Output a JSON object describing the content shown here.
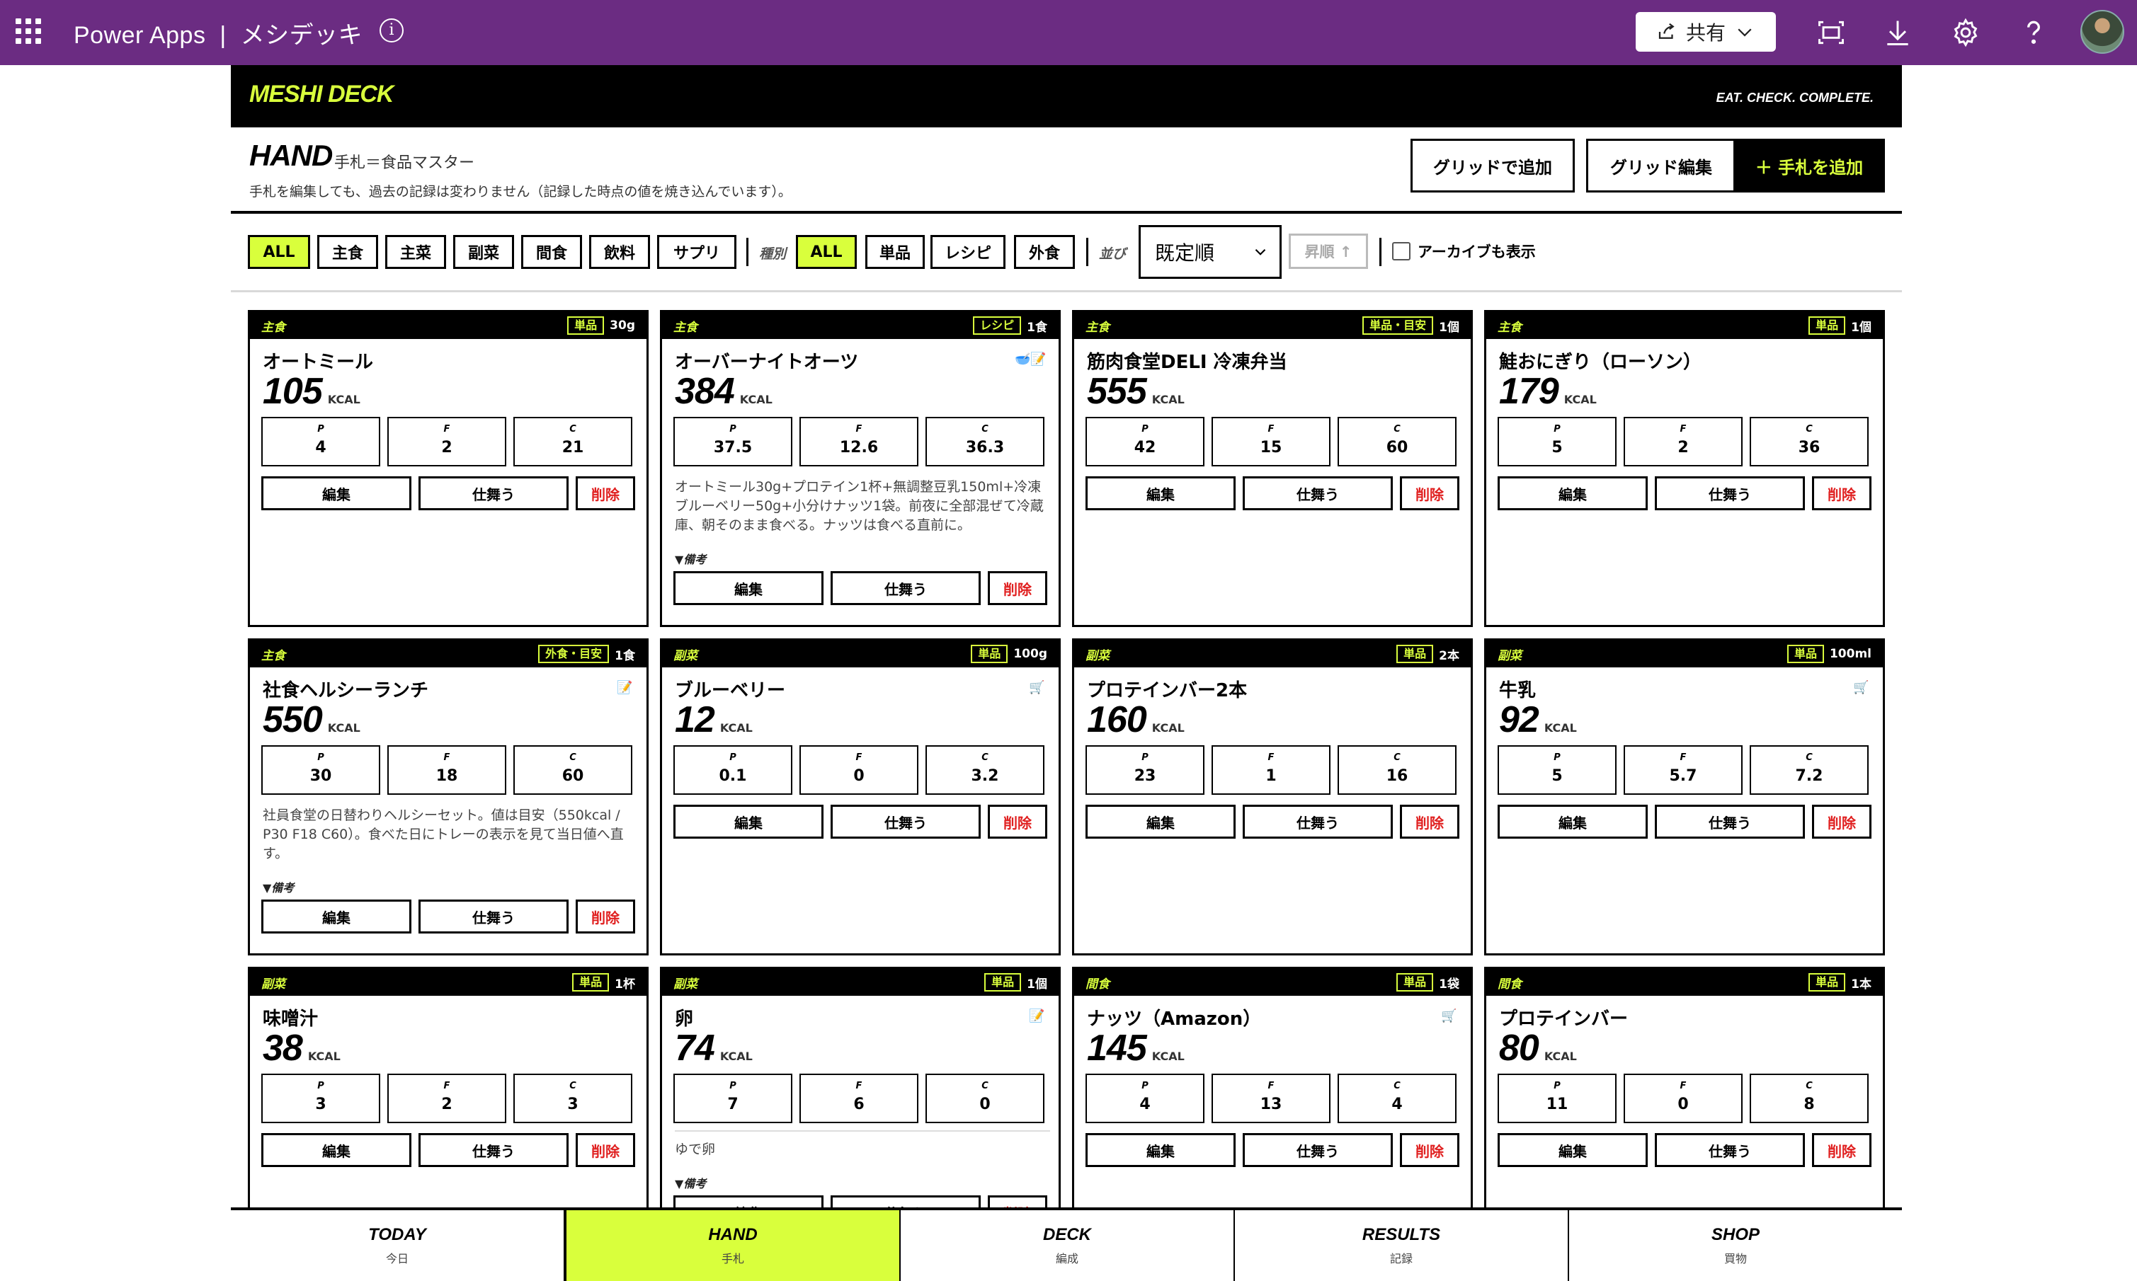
{
  "topbar": {
    "app_name": "Power Apps",
    "separator": "|",
    "app_title": "メシデッキ",
    "share_label": "共有"
  },
  "brand": {
    "logo": "MESHI DECK",
    "tagline": "EAT. CHECK. COMPLETE."
  },
  "hand": {
    "title": "HAND",
    "subtitle": "手札＝食品マスター",
    "note": "手札を編集しても、過去の記録は変わりません（記録した時点の値を焼き込んでいます）。",
    "grid_add": "グリッドで追加",
    "grid_edit": "グリッド編集",
    "add_card": "＋ 手札を追加"
  },
  "filters": {
    "categories": [
      "ALL",
      "主食",
      "主菜",
      "副菜",
      "間食",
      "飲料",
      "サプリ"
    ],
    "kind_label": "種別",
    "kinds": [
      "ALL",
      "単品",
      "レシピ",
      "外食"
    ],
    "sort_label": "並び",
    "sort_value": "既定順",
    "asc_label": "昇順 ↑",
    "archive_label": "アーカイブも表示"
  },
  "card_labels": {
    "kcal": "KCAL",
    "p": "P",
    "f": "F",
    "c": "C",
    "edit": "編集",
    "put_away": "仕舞う",
    "delete": "削除",
    "bikou": "▼備考"
  },
  "cards": [
    {
      "category": "主食",
      "kind": "単品",
      "unit": "30g",
      "name": "オートミール",
      "kcal": "105",
      "p": "4",
      "f": "2",
      "c": "21",
      "memo": "",
      "icon": ""
    },
    {
      "category": "主食",
      "kind": "レシピ",
      "unit": "1食",
      "name": "オーバーナイトオーツ",
      "kcal": "384",
      "p": "37.5",
      "f": "12.6",
      "c": "36.3",
      "memo": "オートミール30g+プロテイン1杯+無調整豆乳150ml+冷凍ブルーベリー50g+小分けナッツ1袋。前夜に全部混ぜて冷蔵庫、朝そのまま食べる。ナッツは食べる直前に。",
      "icon": "bowl-note-icon"
    },
    {
      "category": "主食",
      "kind": "単品・目安",
      "unit": "1個",
      "name": "筋肉食堂DELI 冷凍弁当",
      "kcal": "555",
      "p": "42",
      "f": "15",
      "c": "60",
      "memo": "",
      "icon": ""
    },
    {
      "category": "主食",
      "kind": "単品",
      "unit": "1個",
      "name": "鮭おにぎり（ローソン）",
      "kcal": "179",
      "p": "5",
      "f": "2",
      "c": "36",
      "memo": "",
      "icon": ""
    },
    {
      "category": "主食",
      "kind": "外食・目安",
      "unit": "1食",
      "name": "社食ヘルシーランチ",
      "kcal": "550",
      "p": "30",
      "f": "18",
      "c": "60",
      "memo": "社員食堂の日替わりヘルシーセット。値は目安（550kcal / P30 F18 C60）。食べた日にトレーの表示を見て当日値へ直す。",
      "icon": "note-icon"
    },
    {
      "category": "副菜",
      "kind": "単品",
      "unit": "100g",
      "name": "ブルーベリー",
      "kcal": "12",
      "p": "0.1",
      "f": "0",
      "c": "3.2",
      "memo": "",
      "icon": "cart-icon"
    },
    {
      "category": "副菜",
      "kind": "単品",
      "unit": "2本",
      "name": "プロテインバー2本",
      "kcal": "160",
      "p": "23",
      "f": "1",
      "c": "16",
      "memo": "",
      "icon": ""
    },
    {
      "category": "副菜",
      "kind": "単品",
      "unit": "100ml",
      "name": "牛乳",
      "kcal": "92",
      "p": "5",
      "f": "5.7",
      "c": "7.2",
      "memo": "",
      "icon": "cart-icon"
    },
    {
      "category": "副菜",
      "kind": "単品",
      "unit": "1杯",
      "name": "味噌汁",
      "kcal": "38",
      "p": "3",
      "f": "2",
      "c": "3",
      "memo": "",
      "icon": ""
    },
    {
      "category": "副菜",
      "kind": "単品",
      "unit": "1個",
      "name": "卵",
      "kcal": "74",
      "p": "7",
      "f": "6",
      "c": "0",
      "memo": "ゆで卵",
      "icon": "note-icon"
    },
    {
      "category": "間食",
      "kind": "単品",
      "unit": "1袋",
      "name": "ナッツ（Amazon）",
      "kcal": "145",
      "p": "4",
      "f": "13",
      "c": "4",
      "memo": "",
      "icon": "cart-icon"
    },
    {
      "category": "間食",
      "kind": "単品",
      "unit": "1本",
      "name": "プロテインバー",
      "kcal": "80",
      "p": "11",
      "f": "0",
      "c": "8",
      "memo": "",
      "icon": ""
    }
  ],
  "bottom_nav": [
    {
      "en": "TODAY",
      "jp": "今日"
    },
    {
      "en": "HAND",
      "jp": "手札"
    },
    {
      "en": "DECK",
      "jp": "編成"
    },
    {
      "en": "RESULTS",
      "jp": "記録"
    },
    {
      "en": "SHOP",
      "jp": "買物"
    }
  ],
  "colors": {
    "topbar": "#6b2c82",
    "accent": "#d9ff3c",
    "delete": "#e02020"
  }
}
